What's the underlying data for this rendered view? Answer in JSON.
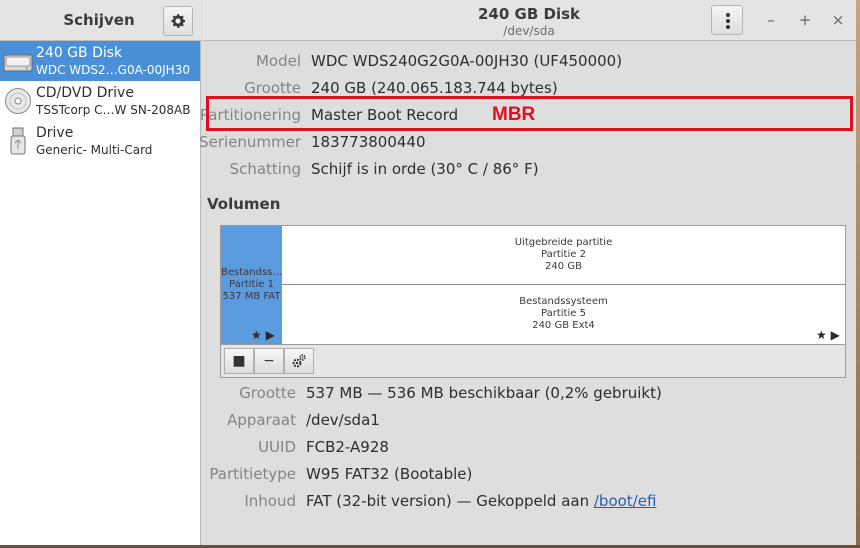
{
  "sidebar": {
    "title": "Schijven",
    "settings_icon": "gear-icon",
    "drives": [
      {
        "name": "240 GB Disk",
        "sub": "WDC WDS2…G0A-00JH30",
        "icon": "hard-disk-icon",
        "selected": true
      },
      {
        "name": "CD/DVD Drive",
        "sub": "TSSTcorp C…W SN-208AB",
        "icon": "optical-disc-icon",
        "selected": false
      },
      {
        "name": "Drive",
        "sub": "Generic- Multi-Card",
        "icon": "usb-drive-icon",
        "selected": false
      }
    ]
  },
  "header": {
    "title": "240 GB Disk",
    "subtitle": "/dev/sda",
    "menu_icon": "vertical-dots-icon",
    "minimize": "–",
    "maximize": "+",
    "close": "×"
  },
  "disk_info": [
    {
      "label": "Model",
      "value": "WDC WDS240G2G0A-00JH30 (UF450000)"
    },
    {
      "label": "Grootte",
      "value": "240 GB (240.065.183.744 bytes)"
    },
    {
      "label": "Partitionering",
      "value": "Master Boot Record"
    },
    {
      "label": "Serienummer",
      "value": "183773800440"
    },
    {
      "label": "Schatting",
      "value": "Schijf is in orde (30° C / 86° F)"
    }
  ],
  "annotation": {
    "text": "MBR",
    "color": "#e0101e"
  },
  "volumes": {
    "title": "Volumen",
    "partition1": {
      "line1": "Bestandss…",
      "line2": "Partitie 1",
      "line3": "537 MB FAT",
      "flag": "★ ▶"
    },
    "extended": {
      "line1": "Uitgebreide partitie",
      "line2": "Partitie 2",
      "line3": "240 GB"
    },
    "partition5": {
      "line1": "Bestandssysteem",
      "line2": "Partitie 5",
      "line3": "240 GB Ext4",
      "flag": "★ ▶"
    },
    "toolbar": {
      "stop": "■",
      "remove": "−",
      "settings_icon": "gears-icon"
    }
  },
  "volume_info": [
    {
      "label": "Grootte",
      "value": "537 MB — 536 MB beschikbaar (0,2% gebruikt)"
    },
    {
      "label": "Apparaat",
      "value": "/dev/sda1"
    },
    {
      "label": "UUID",
      "value": "FCB2-A928"
    },
    {
      "label": "Partitietype",
      "value": "W95 FAT32 (Bootable)"
    },
    {
      "label": "Inhoud",
      "value": "FAT (32-bit version) — Gekoppeld aan ",
      "link": "/boot/efi"
    }
  ],
  "colors": {
    "selection": "#4a90d9",
    "partition_selected": "#5b9be0",
    "highlight_box": "#e0101e"
  }
}
